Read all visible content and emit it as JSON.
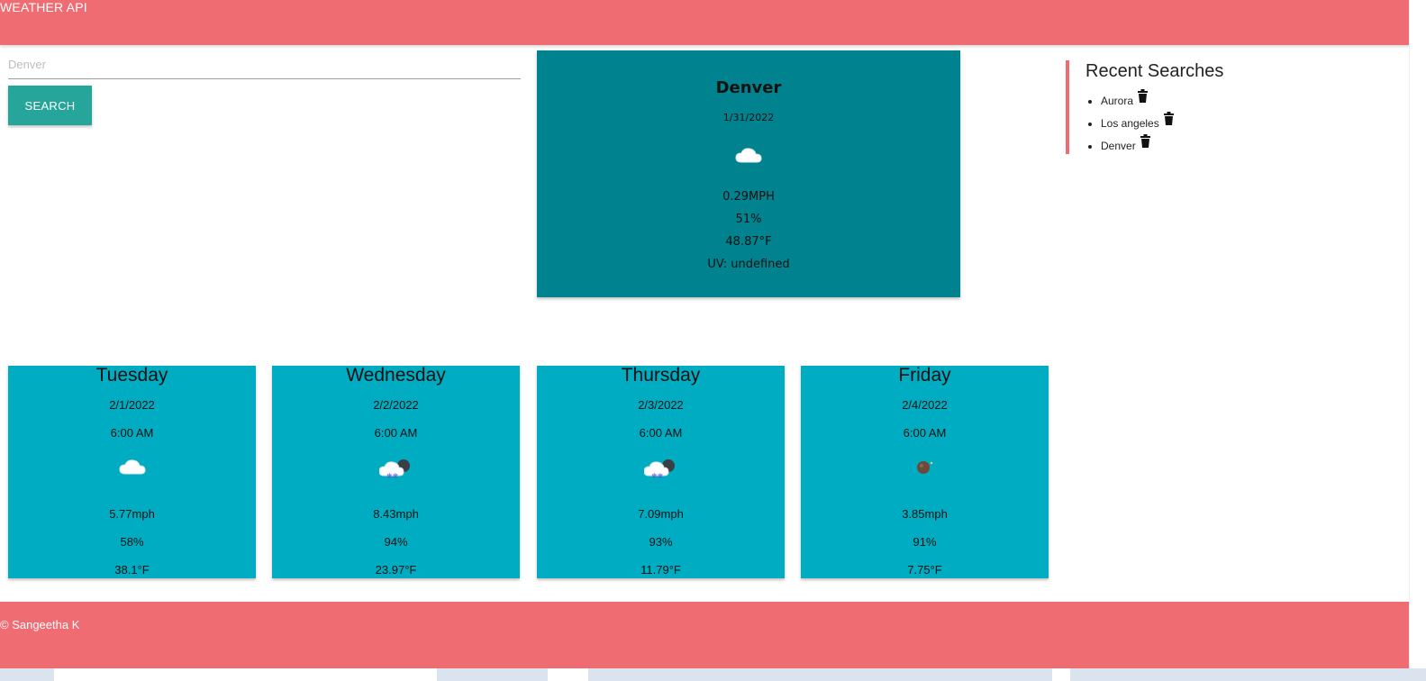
{
  "header": {
    "title": "WEATHER API"
  },
  "search": {
    "placeholder": "Denver",
    "button_label": "SEARCH"
  },
  "current": {
    "city": "Denver",
    "date": "1/31/2022",
    "icon": "cloud-icon",
    "wind": "0.29MPH",
    "humidity": "51%",
    "temperature": "48.87°F",
    "uv": "UV: undefined"
  },
  "recent": {
    "heading": "Recent Searches",
    "items": [
      {
        "label": "Aurora",
        "icon": "trash-icon"
      },
      {
        "label": "Los angeles",
        "icon": "trash-icon"
      },
      {
        "label": "Denver",
        "icon": "trash-icon"
      }
    ]
  },
  "forecast": [
    {
      "day": "Tuesday",
      "date": "2/1/2022",
      "time": "6:00 AM",
      "icon": "cloud-icon",
      "wind": "5.77mph",
      "humidity": "58%",
      "temperature": "38.1°F"
    },
    {
      "day": "Wednesday",
      "date": "2/2/2022",
      "time": "6:00 AM",
      "icon": "snow-cloud-icon",
      "wind": "8.43mph",
      "humidity": "94%",
      "temperature": "23.97°F"
    },
    {
      "day": "Thursday",
      "date": "2/3/2022",
      "time": "6:00 AM",
      "icon": "snow-cloud-icon",
      "wind": "7.09mph",
      "humidity": "93%",
      "temperature": "11.79°F"
    },
    {
      "day": "Friday",
      "date": "2/4/2022",
      "time": "6:00 AM",
      "icon": "clear-night-icon",
      "wind": "3.85mph",
      "humidity": "91%",
      "temperature": "7.75°F"
    }
  ],
  "footer": {
    "copyright": "© Sangeetha K"
  },
  "colors": {
    "header": "#ef6c73",
    "button": "#26a69a",
    "current_card": "#00838f",
    "forecast_card": "#00acc1"
  }
}
